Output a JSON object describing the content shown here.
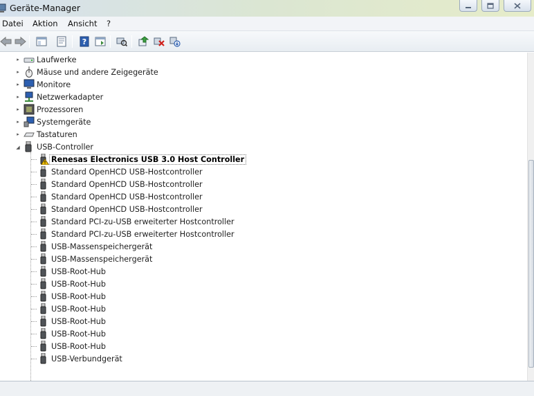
{
  "window": {
    "title": "Geräte-Manager"
  },
  "menu": {
    "items": [
      "Datei",
      "Aktion",
      "Ansicht",
      "?"
    ]
  },
  "toolbar": {
    "buttons": [
      "back-icon",
      "forward-icon",
      "show-hide-tree-icon",
      "properties-icon",
      "help-icon",
      "console-tree-icon",
      "scan-hardware-icon",
      "update-driver-icon",
      "uninstall-icon",
      "disable-device-icon"
    ]
  },
  "tree": {
    "categories": [
      {
        "label": "Laufwerke",
        "icon": "disk-drive-icon",
        "state": "collapsed"
      },
      {
        "label": "Mäuse und andere Zeigegeräte",
        "icon": "mouse-icon",
        "state": "collapsed"
      },
      {
        "label": "Monitore",
        "icon": "monitor-icon",
        "state": "collapsed"
      },
      {
        "label": "Netzwerkadapter",
        "icon": "network-adapter-icon",
        "state": "collapsed"
      },
      {
        "label": "Prozessoren",
        "icon": "processor-icon",
        "state": "collapsed"
      },
      {
        "label": "Systemgeräte",
        "icon": "system-device-icon",
        "state": "collapsed"
      },
      {
        "label": "Tastaturen",
        "icon": "keyboard-icon",
        "state": "collapsed"
      },
      {
        "label": "USB-Controller",
        "icon": "usb-icon",
        "state": "expanded"
      }
    ],
    "usb_children": [
      {
        "label": "Renesas Electronics USB 3.0 Host Controller",
        "warning": true,
        "selected": true
      },
      {
        "label": "Standard OpenHCD USB-Hostcontroller"
      },
      {
        "label": "Standard OpenHCD USB-Hostcontroller"
      },
      {
        "label": "Standard OpenHCD USB-Hostcontroller"
      },
      {
        "label": "Standard OpenHCD USB-Hostcontroller"
      },
      {
        "label": "Standard PCI-zu-USB erweiterter Hostcontroller"
      },
      {
        "label": "Standard PCI-zu-USB erweiterter Hostcontroller"
      },
      {
        "label": "USB-Massenspeichergerät"
      },
      {
        "label": "USB-Massenspeichergerät"
      },
      {
        "label": "USB-Root-Hub"
      },
      {
        "label": "USB-Root-Hub"
      },
      {
        "label": "USB-Root-Hub"
      },
      {
        "label": "USB-Root-Hub"
      },
      {
        "label": "USB-Root-Hub"
      },
      {
        "label": "USB-Root-Hub"
      },
      {
        "label": "USB-Root-Hub"
      },
      {
        "label": "USB-Verbundgerät"
      }
    ]
  },
  "colors": {
    "warning": "#f5c400",
    "selection_border": "#777777",
    "title_gradient_start": "#d6e1ee",
    "title_gradient_end": "#e6ecc9"
  }
}
